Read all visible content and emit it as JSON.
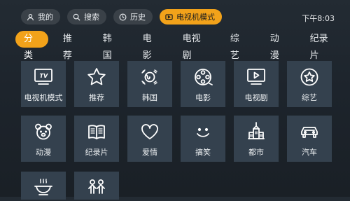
{
  "top_nav": [
    {
      "label": "我的",
      "icon": "user-icon",
      "active": false
    },
    {
      "label": "搜索",
      "icon": "search-icon",
      "active": false
    },
    {
      "label": "历史",
      "icon": "clock-icon",
      "active": false
    },
    {
      "label": "电视机模式",
      "icon": "tv-icon",
      "active": true
    }
  ],
  "clock": "下午8:03",
  "category_tabs": [
    "分类",
    "推荐",
    "韩国",
    "电影",
    "电视剧",
    "综艺",
    "动漫",
    "纪录片"
  ],
  "active_tab": "分类",
  "grid_items": [
    {
      "label": "电视机模式",
      "icon": "tv-mode-icon"
    },
    {
      "label": "推荐",
      "icon": "star-icon"
    },
    {
      "label": "韩国",
      "icon": "korea-flag-icon"
    },
    {
      "label": "电影",
      "icon": "film-reel-icon"
    },
    {
      "label": "电视剧",
      "icon": "tv-play-icon"
    },
    {
      "label": "综艺",
      "icon": "star-circle-icon"
    },
    {
      "label": "动漫",
      "icon": "bear-icon"
    },
    {
      "label": "纪录片",
      "icon": "book-icon"
    },
    {
      "label": "爱情",
      "icon": "heart-icon"
    },
    {
      "label": "搞笑",
      "icon": "smile-icon"
    },
    {
      "label": "都市",
      "icon": "city-icon"
    },
    {
      "label": "汽车",
      "icon": "car-icon"
    },
    {
      "label": "",
      "icon": "food-icon"
    },
    {
      "label": "",
      "icon": "kids-icon"
    }
  ],
  "colors": {
    "accent": "#f2a21a",
    "card": "#34414e",
    "background": "#1e252c"
  }
}
